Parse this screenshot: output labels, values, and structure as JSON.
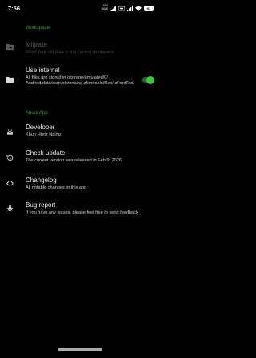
{
  "status_bar": {
    "time": "7:56",
    "net_speed_top": "10.0",
    "net_speed_bottom": "KB/S",
    "battery": "91"
  },
  "workspace_section": {
    "header": "Workspace",
    "migrate": {
      "title": "Migrate",
      "subtitle": "Move your old data to the current workspace",
      "icon": "folder-move-icon"
    },
    "use_internal": {
      "title": "Use internal",
      "subtitle": "All files are stored in /storage/emulated/0/ Android/data/com.htetznaing.zfonttools/files/ zFontTool",
      "icon": "folder-icon",
      "enabled": true
    }
  },
  "about_section": {
    "header": "About App",
    "developer": {
      "title": "Developer",
      "subtitle": "Khun Htetz Naing",
      "icon": "android-icon"
    },
    "check_update": {
      "title": "Check update",
      "subtitle": "The current version was released in Feb 9, 2026",
      "icon": "history-icon"
    },
    "changelog": {
      "title": "Changelog",
      "subtitle": "All notable changes to this app",
      "icon": "code-icon"
    },
    "bug_report": {
      "title": "Bug report",
      "subtitle": "If you have any issues, please feel free to send feedback",
      "icon": "bug-icon"
    }
  },
  "colors": {
    "background": "#000000",
    "accent": "#3a9a3a",
    "toggle_on": "#3cc83c"
  }
}
